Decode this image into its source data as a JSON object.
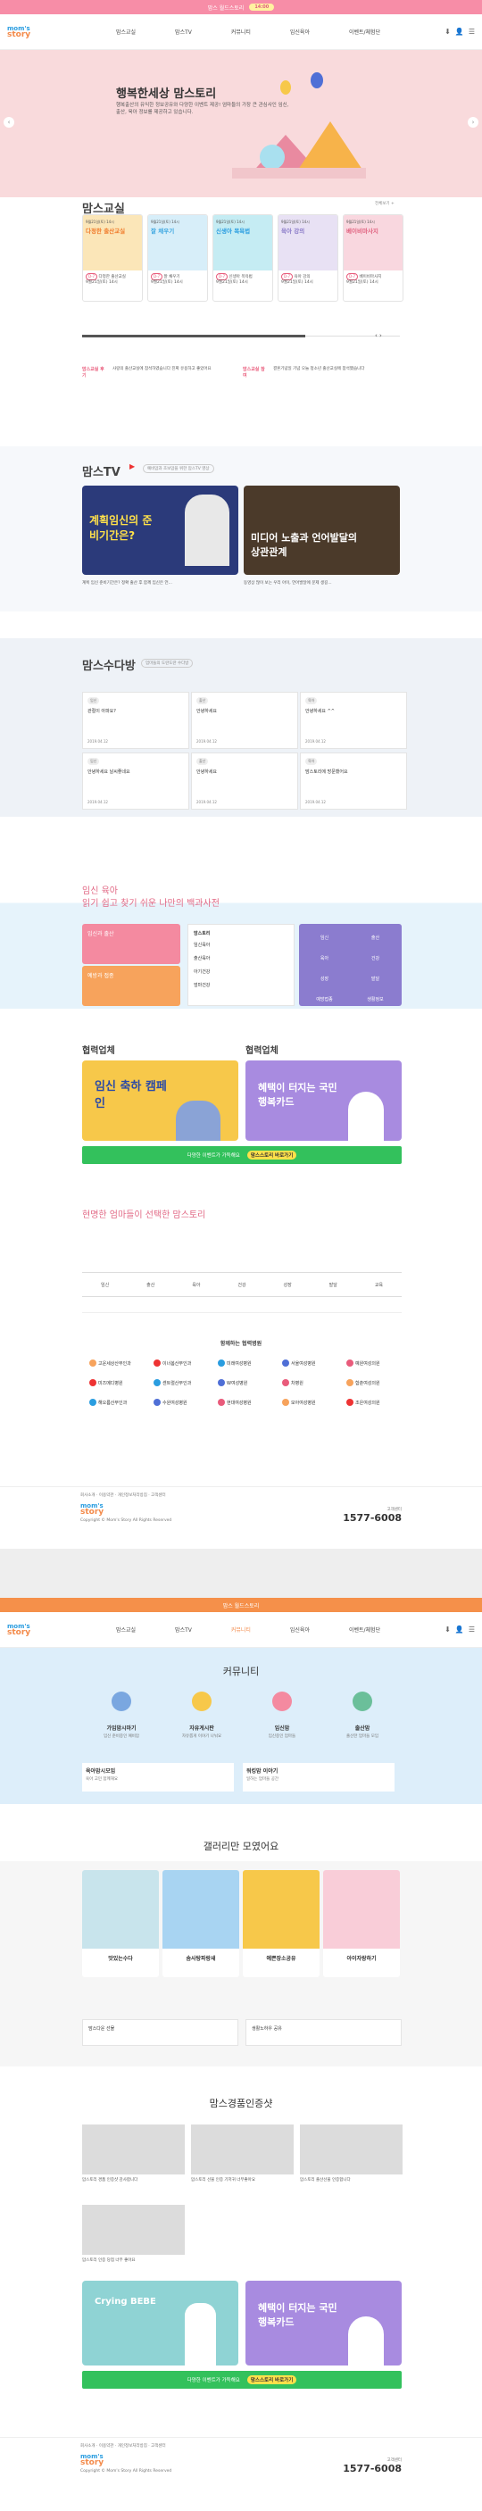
{
  "topbar": {
    "text": "맘스 월드스토리",
    "pill": "14:00"
  },
  "header": {
    "logo_top": "mom's",
    "logo_bottom": "story",
    "nav": [
      "맘스교실",
      "맘스TV",
      "커뮤니티",
      "임신육아",
      "이벤트/체험단"
    ]
  },
  "hero": {
    "title": "행복한세상 맘스토리",
    "desc": "행복출산의 유익한 정보공유와 다양한 이벤트 제공! 엄마들의 가장 큰 관심사인 임신, 출산, 육아 정보를 제공하고 있습니다."
  },
  "classroom": {
    "title": "맘스교실",
    "more": "전체보기 +",
    "cards": [
      {
        "date": "9월21일(토) 14시",
        "title": "다정한 출산교실",
        "color": "#fbe6b8",
        "accent": "#f07a2a"
      },
      {
        "date": "9월21일(토) 14시",
        "title": "잘 채우기",
        "color": "#d7eef9",
        "accent": "#3ba6e0"
      },
      {
        "date": "9월21일(토) 14시",
        "title": "신생아 목욕법",
        "color": "#c5ecf3",
        "accent": "#2a9de0"
      },
      {
        "date": "9월21일(토) 14시",
        "title": "육아 강의",
        "color": "#e8e1f4",
        "accent": "#8a7ac8"
      },
      {
        "date": "9월21일(토) 14시",
        "title": "베이비마사지",
        "color": "#f9d7df",
        "accent": "#e0607e"
      }
    ],
    "sub": [
      {
        "label": "맘스교실 후기",
        "text": "사랑의 출산교실에 참석하였습니다 진짜 유용하고 좋았어요"
      },
      {
        "label": "맘스교실 참여",
        "text": "결혼기념일 기념 오늘 청소년 출산교실에 참석했습니다"
      }
    ]
  },
  "tv": {
    "title": "맘스TV",
    "tag": "예비맘과 초보맘을 위한 맘스TV 영상",
    "thumbs": [
      {
        "text": "계획임신의 준비기간은?",
        "caption": "계획 임신 준비기간은? 정확 출산 후 함께 임신은 언..."
      },
      {
        "text": "미디어 노출과 언어발달의 상관관계",
        "caption": "동영상 많이 보는 우리 아이, 언어발달에 문제 생길..."
      }
    ]
  },
  "qa": {
    "title": "맘스수다방",
    "tag": "엄마들의 도란도란 수다방",
    "items": [
      {
        "chip": "임신",
        "title": "관절이 아파요?"
      },
      {
        "chip": "출산",
        "title": "안녕하세요"
      },
      {
        "chip": "육아",
        "title": "안녕하세요 ^^"
      },
      {
        "chip": "임신",
        "title": "안녕하세요 날씨좋네요"
      },
      {
        "chip": "출산",
        "title": "안녕하세요"
      },
      {
        "chip": "육아",
        "title": "맘스토리에 방문했어요"
      }
    ],
    "date": "2019.04.12"
  },
  "wiki": {
    "sub": "임신 육아",
    "title": "읽기 쉽고 찾기 쉬운 나만의 백과사전",
    "left": [
      {
        "t": "임신과 출산",
        "c": "#f48aa0"
      },
      {
        "t": "예방과 접종",
        "c": "#f7a35c"
      }
    ],
    "list_title": "맘스토리",
    "list": [
      "임신육아",
      "출산육아",
      "아기건강",
      "엄마건강"
    ],
    "right_cells": [
      "임신",
      "출산",
      "육아",
      "건강",
      "성장",
      "발달",
      "예방접종",
      "생활정보"
    ]
  },
  "partners_top": {
    "left_title": "협력업체",
    "right_title": "협력업체",
    "left_banner": "임신 축하 캠페인",
    "right_banner": "혜택이 터지는 국민행복카드",
    "green": "다양한 이벤트가 가득해요",
    "green_btn": "맘스스토리 바로가기"
  },
  "smart": {
    "title": "현명한 엄마들이 선택한 맘스토리",
    "icons": [
      "임신",
      "출산",
      "육아",
      "건강",
      "성장",
      "발달",
      "교육"
    ]
  },
  "hospital": {
    "title": "함께하는 협력병원",
    "names": [
      "고운세상산부인과",
      "이너봄산부인과",
      "미래여성병원",
      "서울여성병원",
      "예원여성의원",
      "미즈메디병원",
      "센트럴산부인과",
      "W여성병원",
      "차병원",
      "함춘여성의원",
      "해오름산부인과",
      "수원여성병원",
      "현대여성병원",
      "모아여성병원",
      "조은여성의원"
    ]
  },
  "footer": {
    "links": [
      "회사소개",
      "이용약관",
      "개인정보처리방침",
      "고객센터"
    ],
    "call_label": "고객센터",
    "phone": "1577-6008",
    "copy": "Copyright © Mom's Story All Rights Reserved"
  },
  "page2": {
    "topbar": "맘스 월드스토리",
    "community": {
      "title": "커뮤니티",
      "cells": [
        {
          "t": "가임맘시마기",
          "s": "임신 준비중인 예비맘"
        },
        {
          "t": "자유게시판",
          "s": "자유롭게 이야기 나눠요"
        },
        {
          "t": "임신맘",
          "s": "임신중인 엄마들"
        },
        {
          "t": "출산맘",
          "s": "출산한 엄마들 모임"
        }
      ],
      "extra": [
        {
          "t": "육아맘시모임",
          "s": "육아 고민 함께해요"
        },
        {
          "t": "워킹맘 이야기",
          "s": "일하는 엄마들 공간"
        }
      ]
    },
    "gallery": {
      "title": "갤러리만 모였어요",
      "items": [
        {
          "t": "맛있는수다",
          "c": "#c8e4ec"
        },
        {
          "t": "솜사탕파랑새",
          "c": "#a8d4f2"
        },
        {
          "t": "예쁜장소공유",
          "c": "#f7c84a"
        },
        {
          "t": "아이자랑하기",
          "c": "#f9cdd8"
        }
      ],
      "banner_left": "맘스다운 선물",
      "banner_right": "생활노하우 공유"
    },
    "review": {
      "title": "맘스경품인증샷",
      "items": [
        "맘스토리 경품 인증샷 감사합니다",
        "맘스토리 선물 인증 기저귀 너무좋아요",
        "맘스토리 출산선물 인증합니다",
        "맘스토리 인증 당첨 너무 좋아요"
      ]
    },
    "banner_left": "Crying BEBE",
    "banner_right": "혜택이 터지는 국민행복카드",
    "green": "다양한 이벤트가 가득해요",
    "green_btn": "맘스스토리 바로가기"
  }
}
